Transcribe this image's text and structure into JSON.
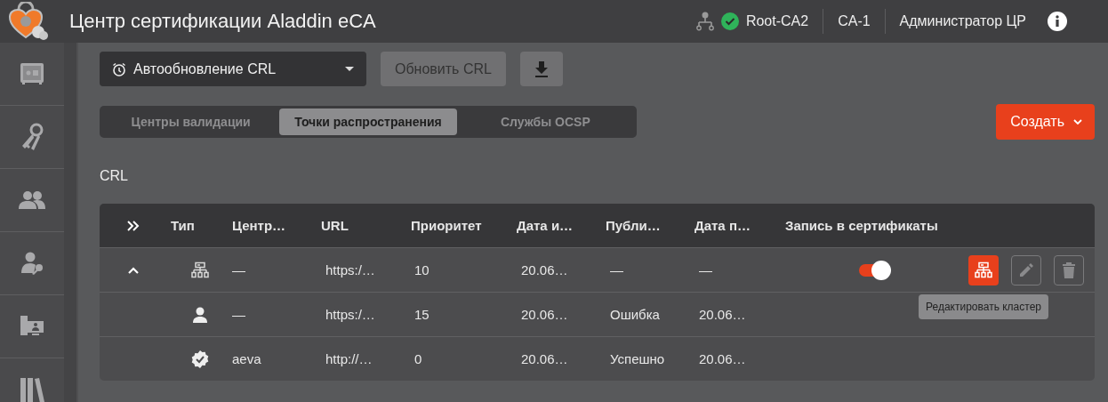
{
  "header": {
    "title": "Центр сертификации Aladdin eCA",
    "ca_name": "Root-CA2",
    "ca_online": true,
    "node": "CA-1",
    "user": "Администратор ЦР"
  },
  "toolbar": {
    "auto_update": "Автообновление CRL",
    "refresh_button": "Обновить CRL",
    "create_button": "Создать"
  },
  "tabs": [
    {
      "label": "Центры валидации",
      "selected": false
    },
    {
      "label": "Точки распространения",
      "selected": true
    },
    {
      "label": "Службы OCSP",
      "selected": false
    }
  ],
  "section_title": "CRL",
  "table": {
    "columns": [
      "Тип",
      "Центр…",
      "URL",
      "Приоритет",
      "Дата и…",
      "Публи…",
      "Дата п…",
      "Запись в сертификаты"
    ],
    "rows": [
      {
        "kind": "cluster",
        "expanded": true,
        "center": "—",
        "url": "https:/…",
        "priority": "10",
        "issue_date": "20.06…",
        "publication": "—",
        "next_date": "—",
        "write_to_certificates": true,
        "actions": [
          {
            "kind": "cluster",
            "highlighted": true,
            "tooltip": "Редактировать кластер"
          },
          {
            "kind": "edit",
            "highlighted": false
          },
          {
            "kind": "delete",
            "highlighted": false
          }
        ],
        "children": [
          {
            "kind": "user",
            "center": "—",
            "url": "https:/…",
            "priority": "15",
            "issue_date": "20.06…",
            "publication": "Ошибка",
            "next_date": "20.06…"
          },
          {
            "kind": "verified",
            "center": "aeva",
            "url": "http://…",
            "priority": "0",
            "issue_date": "20.06…",
            "publication": "Успешно",
            "next_date": "20.06…"
          }
        ]
      }
    ]
  }
}
